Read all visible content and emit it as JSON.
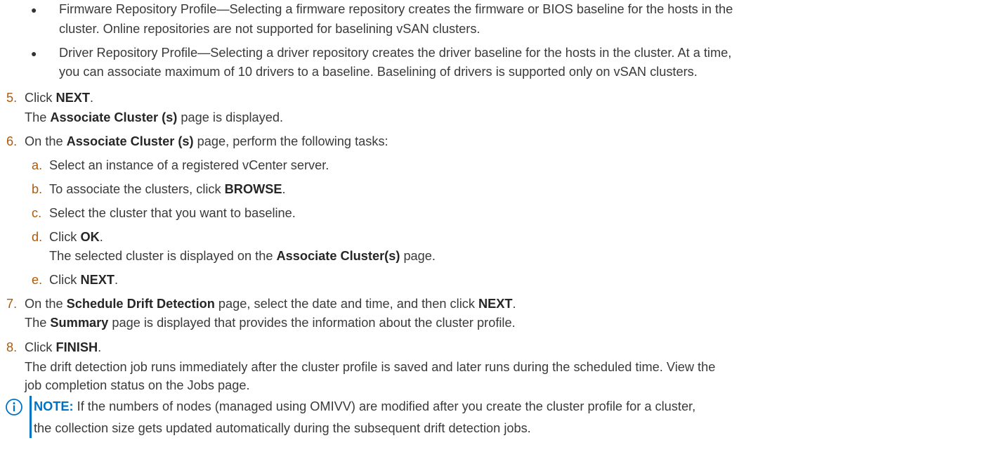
{
  "bullets": [
    {
      "line1": "Firmware Repository Profile—Selecting a firmware repository creates the firmware or BIOS baseline for the hosts in the",
      "line2": "cluster. Online repositories are not supported for baselining vSAN clusters."
    },
    {
      "line1": "Driver Repository Profile—Selecting a driver repository creates the driver baseline for the hosts in the cluster. At a time,",
      "line2": "you can associate maximum of 10 drivers to a baseline. Baselining of drivers is supported only on vSAN clusters."
    }
  ],
  "step5": {
    "num": "5.",
    "text_a": "Click ",
    "bold_a": "NEXT",
    "text_b": ".",
    "result_a": "The ",
    "result_bold": "Associate Cluster (s)",
    "result_b": " page is displayed."
  },
  "step6": {
    "num": "6.",
    "text_a": "On the ",
    "bold_a": "Associate Cluster (s)",
    "text_b": " page, perform the following tasks:",
    "substeps": {
      "a": {
        "letter": "a.",
        "text": "Select an instance of a registered vCenter server."
      },
      "b": {
        "letter": "b.",
        "text": "To associate the clusters, click ",
        "bold": "BROWSE",
        "end": "."
      },
      "c": {
        "letter": "c.",
        "text": "Select the cluster that you want to baseline."
      },
      "d": {
        "letter": "d.",
        "text": "Click ",
        "bold": "OK",
        "end": ".",
        "result_a": "The selected cluster is displayed on the ",
        "result_bold": "Associate Cluster(s)",
        "result_b": " page."
      },
      "e": {
        "letter": "e.",
        "text": "Click ",
        "bold": "NEXT",
        "end": "."
      }
    }
  },
  "step7": {
    "num": "7.",
    "text_a": "On the ",
    "bold_a": "Schedule Drift Detection",
    "text_b": " page, select the date and time, and then click ",
    "bold_b": "NEXT",
    "text_c": ".",
    "result_a": "The ",
    "result_bold": "Summary",
    "result_b": " page is displayed that provides the information about the cluster profile."
  },
  "step8": {
    "num": "8.",
    "text_a": "Click ",
    "bold_a": "FINISH",
    "text_b": ".",
    "result_line1": "The drift detection job runs immediately after the cluster profile is saved and later runs during the scheduled time. View the",
    "result_line2": "job completion status on the Jobs page."
  },
  "note": {
    "label": "NOTE:",
    "line1": " If the numbers of nodes (managed using OMIVV) are modified after you create the cluster profile for a cluster,",
    "line2": "the collection size gets updated automatically during the subsequent drift detection jobs.",
    "icon": "info-icon",
    "accent": "#0072c6"
  },
  "colors": {
    "number": "#ad5a0c",
    "text": "#3a3a3a"
  }
}
